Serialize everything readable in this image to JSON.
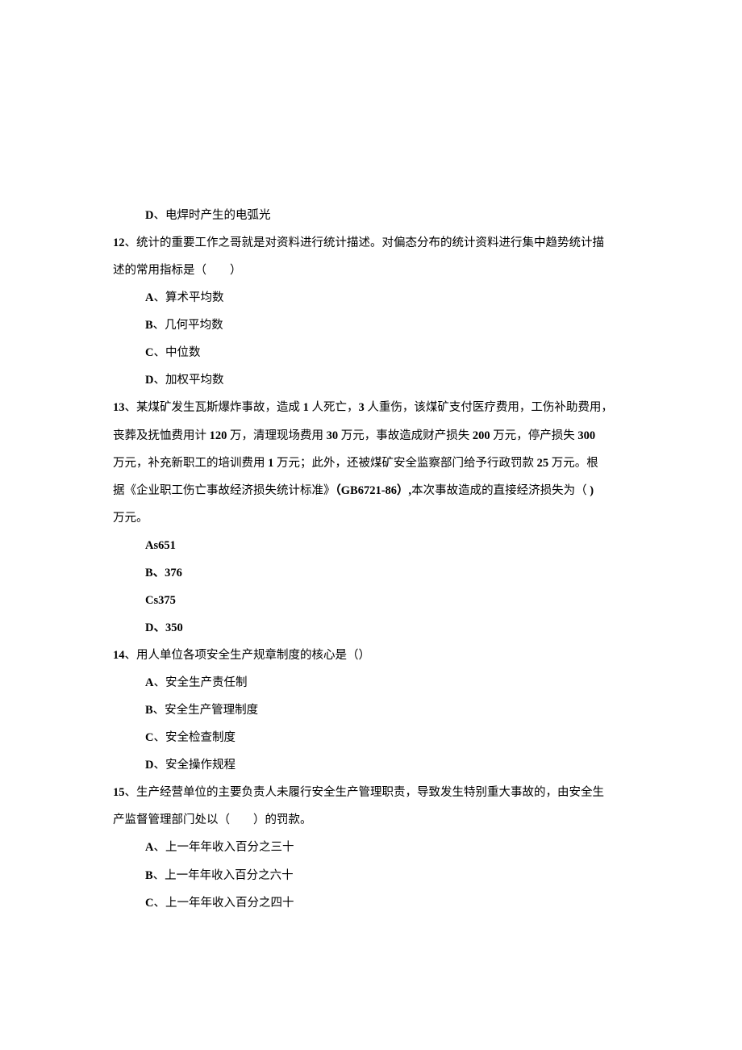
{
  "q11": {
    "option_d": {
      "label": "D",
      "text": "、电焊时产生的电弧光"
    }
  },
  "q12": {
    "number": "12",
    "stem": "、统计的重要工作之哥就是对资料进行统计描述。对偏态分布的统计资料进行集中趋势统计描",
    "stem_cont": "述的常用指标是（　　）",
    "a": {
      "label": "A",
      "text": "、算术平均数"
    },
    "b": {
      "label": "B",
      "text": "、几何平均数"
    },
    "c": {
      "label": "C",
      "text": "、中位数"
    },
    "d": {
      "label": "D",
      "text": "、加权平均数"
    }
  },
  "q13": {
    "number": "13",
    "stem_line1_a": "、某煤矿发生瓦斯爆炸事故，造成",
    "stem_1": " 1 ",
    "stem_line1_b": "人死亡，",
    "stem_3": "3 ",
    "stem_line1_c": "人重伤，该煤矿支付医疗费用，工伤补助费用，",
    "stem_line2_a": "丧葬及抚恤费用计",
    "stem_120": " 120 ",
    "stem_line2_b": "万，清理现场费用",
    "stem_30": " 30 ",
    "stem_line2_c": "万元，事故造成财产损失",
    "stem_200": " 200 ",
    "stem_line2_d": "万元，停产损失",
    "stem_300": " 300",
    "stem_line3_a": "万元，补充新职工的培训费用",
    "stem_1w": " 1 ",
    "stem_line3_b": "万元；此外，还被煤矿安全监察部门给予行政罚款",
    "stem_25": " 25 ",
    "stem_line3_c": "万元。根",
    "stem_line4_a": "据《企业职工伤亡事故经济损失统计标准》",
    "stem_gb": "（GB6721-86）,",
    "stem_line4_b": "本次事故造成的直接经济损失为（",
    "stem_rparen": " )",
    "stem_line5": "万元。",
    "a": {
      "text": "As651"
    },
    "b": {
      "label": "B",
      "text": "、376"
    },
    "c": {
      "text": "Cs375"
    },
    "d": {
      "label": "D",
      "text": "、350"
    }
  },
  "q14": {
    "number": "14",
    "stem": "、用人单位各项安全生产规章制度的核心是（）",
    "a": {
      "label": "A",
      "text": "、安全生产责任制"
    },
    "b": {
      "label": "B",
      "text": "、安全生产管理制度"
    },
    "c": {
      "label": "C",
      "text": "、安全检查制度"
    },
    "d": {
      "label": "D",
      "text": "、安全操作规程"
    }
  },
  "q15": {
    "number": "15",
    "stem_line1": "、生产经营单位的主要负责人未履行安全生产管理职责，导致发生特别重大事故的，由安全生",
    "stem_line2": "产监督管理部门处以（　　）的罚款。",
    "a": {
      "label": "A",
      "text": "、上一年年收入百分之三十"
    },
    "b": {
      "label": "B",
      "text": "、上一年年收入百分之六十"
    },
    "c": {
      "label": "C",
      "text": "、上一年年收入百分之四十"
    }
  }
}
